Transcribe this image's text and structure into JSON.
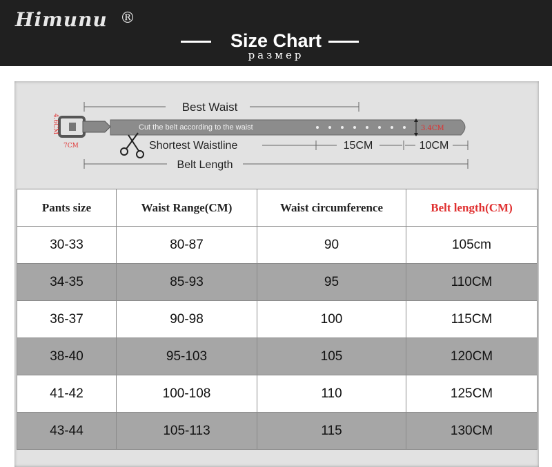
{
  "header": {
    "logo": "Himunu",
    "logo_mark": "®",
    "title": "Size Chart",
    "subtitle": "размер"
  },
  "diagram": {
    "best_waist": "Best Waist",
    "cut_note": "Cut the belt according to the waist",
    "width_label": "3.4CM",
    "buckle_height": "4.6CM",
    "buckle_width": "7CM",
    "shortest": "Shortest Waistline",
    "seg1": "15CM",
    "seg2": "10CM",
    "belt_length": "Belt Length"
  },
  "table": {
    "headers": [
      "Pants size",
      "Waist Range(CM)",
      "Waist circumference",
      "Belt length(CM)"
    ],
    "rows": [
      [
        "30-33",
        "80-87",
        "90",
        "105cm"
      ],
      [
        "34-35",
        "85-93",
        "95",
        "110CM"
      ],
      [
        "36-37",
        "90-98",
        "100",
        "115CM"
      ],
      [
        "38-40",
        "95-103",
        "105",
        "120CM"
      ],
      [
        "41-42",
        "100-108",
        "110",
        "125CM"
      ],
      [
        "43-44",
        "105-113",
        "115",
        "130CM"
      ]
    ],
    "header_highlight_color": "#e03030",
    "alt_row_color": "#a6a6a6"
  }
}
